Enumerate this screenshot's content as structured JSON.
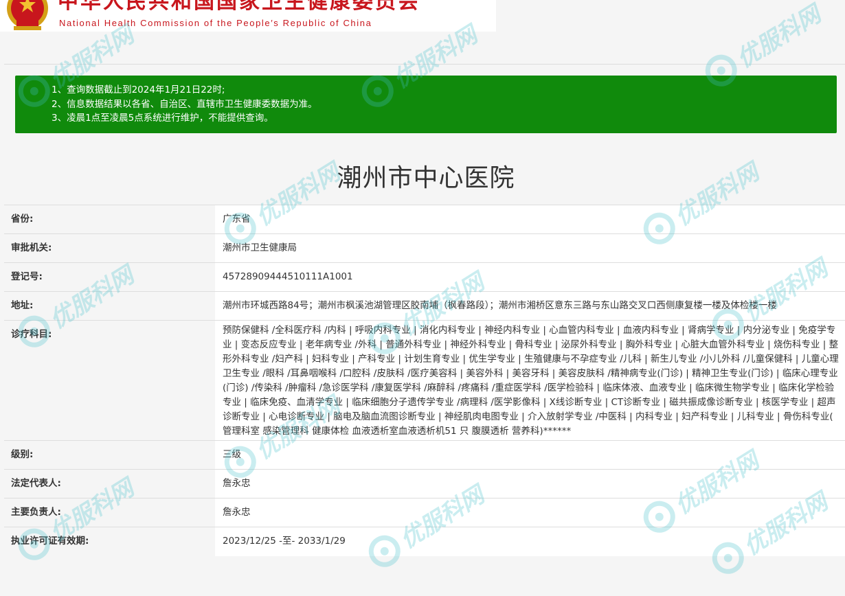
{
  "header": {
    "title_cn": "中华人民共和国国家卫生健康委员会",
    "title_en": "National Health Commission of the People′s Republic of China"
  },
  "notice": {
    "lines": [
      "1、查询数据截止到2024年1月21日22时;",
      "2、信息数据结果以各省、自治区、直辖市卫生健康委数据为准。",
      "3、凌晨1点至凌晨5点系统进行维护，不能提供查询。"
    ]
  },
  "hospital": {
    "name": "潮州市中心医院"
  },
  "fields": [
    {
      "label": "省份:",
      "value": "广东省"
    },
    {
      "label": "审批机关:",
      "value": "潮州市卫生健康局"
    },
    {
      "label": "登记号:",
      "value": "45728909444510111A1001"
    },
    {
      "label": "地址:",
      "value": "潮州市环城西路84号；潮州市枫溪池湖管理区胶南埔（枫春路段）；潮州市湘桥区意东三路与东山路交叉口西侧康复楼一楼及体检楼一楼"
    },
    {
      "label": "诊疗科目:",
      "value": "预防保健科 /全科医疗科 /内科 | 呼吸内科专业 | 消化内科专业 | 神经内科专业 | 心血管内科专业 | 血液内科专业 | 肾病学专业 | 内分泌专业 | 免疫学专业 | 变态反应专业 | 老年病专业 /外科 | 普通外科专业 | 神经外科专业 | 骨科专业 | 泌尿外科专业 | 胸外科专业 | 心脏大血管外科专业 | 烧伤科专业 | 整形外科专业 /妇产科 | 妇科专业 | 产科专业 | 计划生育专业 | 优生学专业 | 生殖健康与不孕症专业 /儿科 | 新生儿专业 /小儿外科 /儿童保健科 | 儿童心理卫生专业 /眼科 /耳鼻咽喉科 /口腔科 /皮肤科 /医疗美容科 | 美容外科 | 美容牙科 | 美容皮肤科 /精神病专业(门诊) | 精神卫生专业(门诊) | 临床心理专业(门诊) /传染科 /肿瘤科 /急诊医学科 /康复医学科 /麻醉科 /疼痛科 /重症医学科 /医学检验科 | 临床体液、血液专业 | 临床微生物学专业 | 临床化学检验专业 | 临床免疫、血清学专业 | 临床细胞分子遗传学专业 /病理科 /医学影像科 | X线诊断专业 | CT诊断专业 | 磁共振成像诊断专业 | 核医学专业 | 超声诊断专业 | 心电诊断专业 | 脑电及脑血流图诊断专业 | 神经肌肉电图专业 | 介入放射学专业 /中医科 | 内科专业 | 妇产科专业 | 儿科专业 | 骨伤科专业( 管理科室 感染管理科 健康体检 血液透析室血液透析机51 只 腹膜透析 营养科)******"
    },
    {
      "label": "级别:",
      "value": "三级"
    },
    {
      "label": "法定代表人:",
      "value": "詹永忠"
    },
    {
      "label": "主要负责人:",
      "value": "詹永忠"
    },
    {
      "label": "执业许可证有效期:",
      "value": "2023/12/25 -至- 2033/1/29"
    }
  ],
  "watermark": {
    "text": "优服科网"
  },
  "colors": {
    "notice_bg": "#108a0c",
    "header_red": "#c8161d",
    "watermark": "#45c1cc"
  }
}
